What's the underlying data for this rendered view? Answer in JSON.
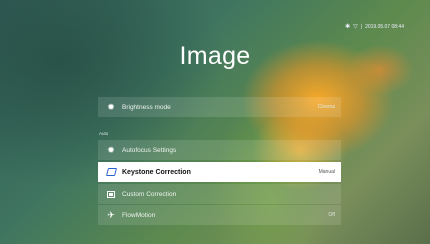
{
  "status": {
    "datetime": "2019.05.07  08:44",
    "bluetooth_icon": "bluetooth-icon",
    "wifi_icon": "wifi-icon",
    "separator": "|"
  },
  "title": "Image",
  "section_label": "Auto",
  "menu": [
    {
      "id": "brightness",
      "label": "Brightness mode",
      "value": "Cinema",
      "icon": "brightness-icon",
      "selected": false
    },
    {
      "id": "autofocus",
      "label": "Autofocus Settings",
      "value": "",
      "icon": "sun-icon",
      "selected": false
    },
    {
      "id": "keystone",
      "label": "Keystone Correction",
      "value": "Manual",
      "icon": "keystone-icon",
      "selected": true
    },
    {
      "id": "custom",
      "label": "Custom Correction",
      "value": "",
      "icon": "custom-correction-icon",
      "selected": false
    },
    {
      "id": "flowmotion",
      "label": "FlowMotion",
      "value": "Off",
      "icon": "flowmotion-icon",
      "selected": false
    }
  ],
  "colors": {
    "selected_bg": "#ffffff",
    "selected_icon": "#2a5fd0"
  }
}
